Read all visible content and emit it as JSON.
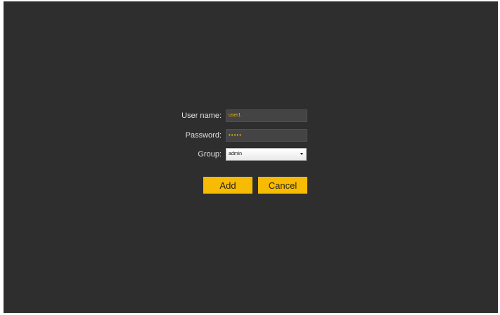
{
  "form": {
    "username_label": "User name:",
    "username_value": "user1",
    "password_label": "Password:",
    "password_value": "•••••",
    "group_label": "Group:",
    "group_value": "admin",
    "add_button": "Add",
    "cancel_button": "Cancel"
  },
  "colors": {
    "background": "#2d2e2d",
    "accent": "#f7bb03",
    "field_text": "#f2b705",
    "label_text": "#e1e1e1"
  },
  "icons": {
    "dropdown": "chevron-down-icon"
  }
}
